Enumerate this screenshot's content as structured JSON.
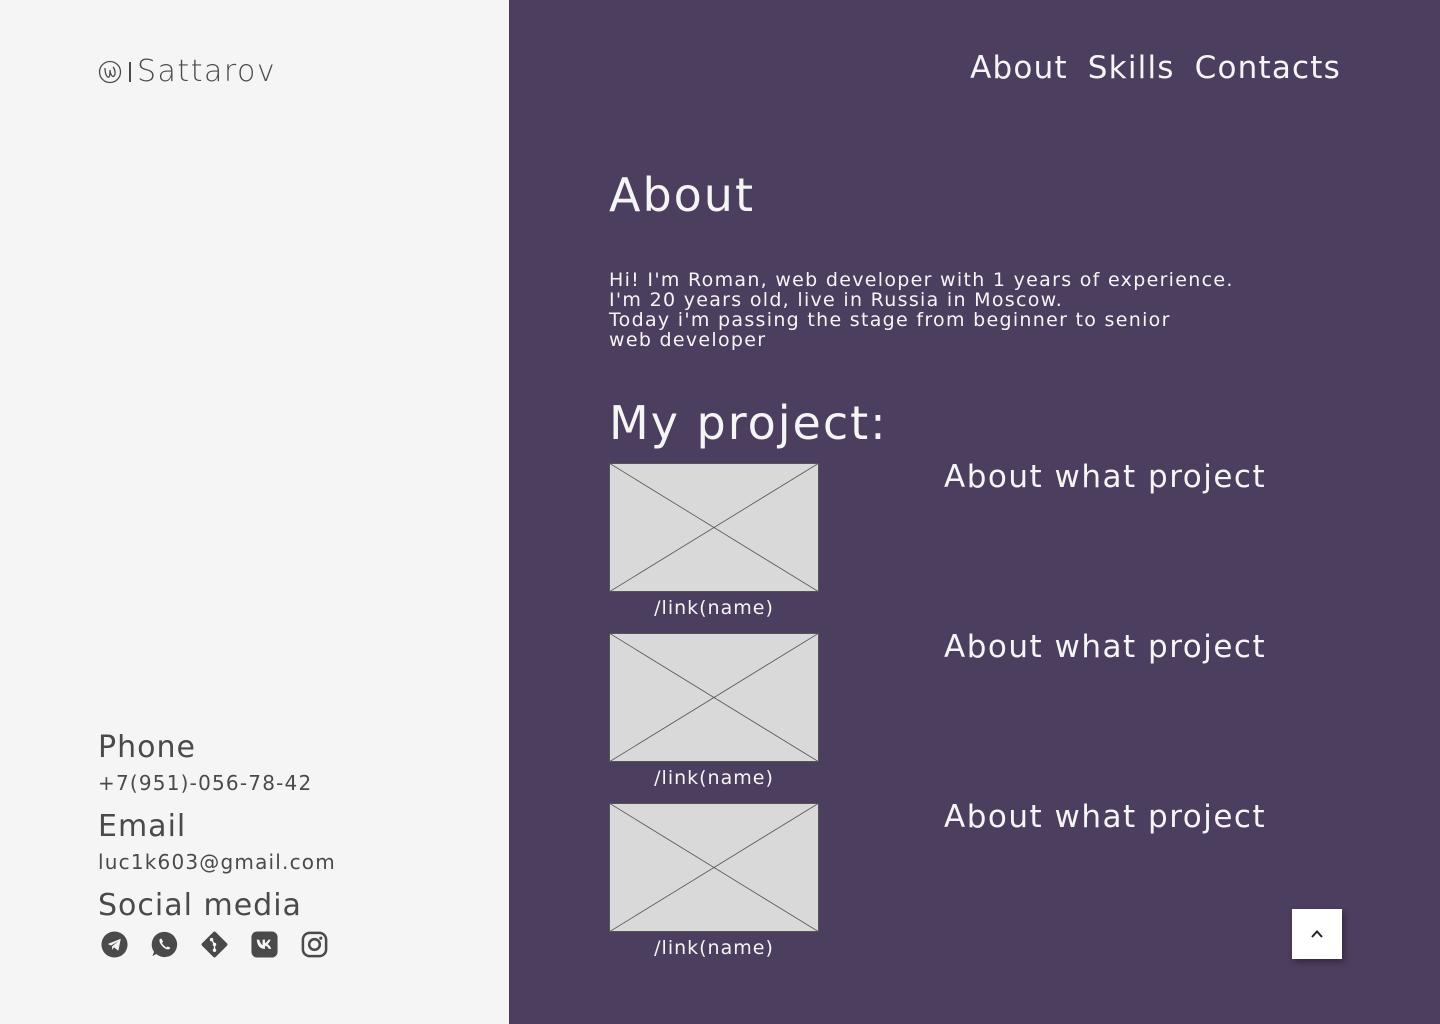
{
  "brand": {
    "name": "Sattarov",
    "icon": "logo-mark-icon"
  },
  "nav": {
    "items": [
      {
        "label": "About"
      },
      {
        "label": "Skills"
      },
      {
        "label": "Contacts"
      }
    ]
  },
  "about": {
    "title": "About",
    "lines": [
      "Hi! I'm Roman, web developer with 1 years of experience.",
      "I'm 20 years old, live in Russia in Moscow.",
      "Today i'm passing the stage from beginner to senior",
      "web developer"
    ]
  },
  "projects": {
    "title": "My project:",
    "items": [
      {
        "link": "/link(name)",
        "description": "About what project",
        "image_icon": "placeholder-image-icon"
      },
      {
        "link": "/link(name)",
        "description": "About what project",
        "image_icon": "placeholder-image-icon"
      },
      {
        "link": "/link(name)",
        "description": "About what project",
        "image_icon": "placeholder-image-icon"
      }
    ]
  },
  "contacts": {
    "phone_heading": "Phone",
    "phone": "+7(951)-056-78-42",
    "email_heading": "Email",
    "email": "luc1k603@gmail.com",
    "social_heading": "Social media",
    "socials": [
      "telegram-icon",
      "whatsapp-icon",
      "git-icon",
      "vk-icon",
      "instagram-icon"
    ]
  },
  "colors": {
    "left_background": "#f5f5f5",
    "right_background": "#4c3e5e",
    "dark_text": "#4a4a4a",
    "light_text": "#f5f5f5",
    "placeholder": "#d9d9d9"
  },
  "scroll_top_icon": "chevron-up-icon"
}
